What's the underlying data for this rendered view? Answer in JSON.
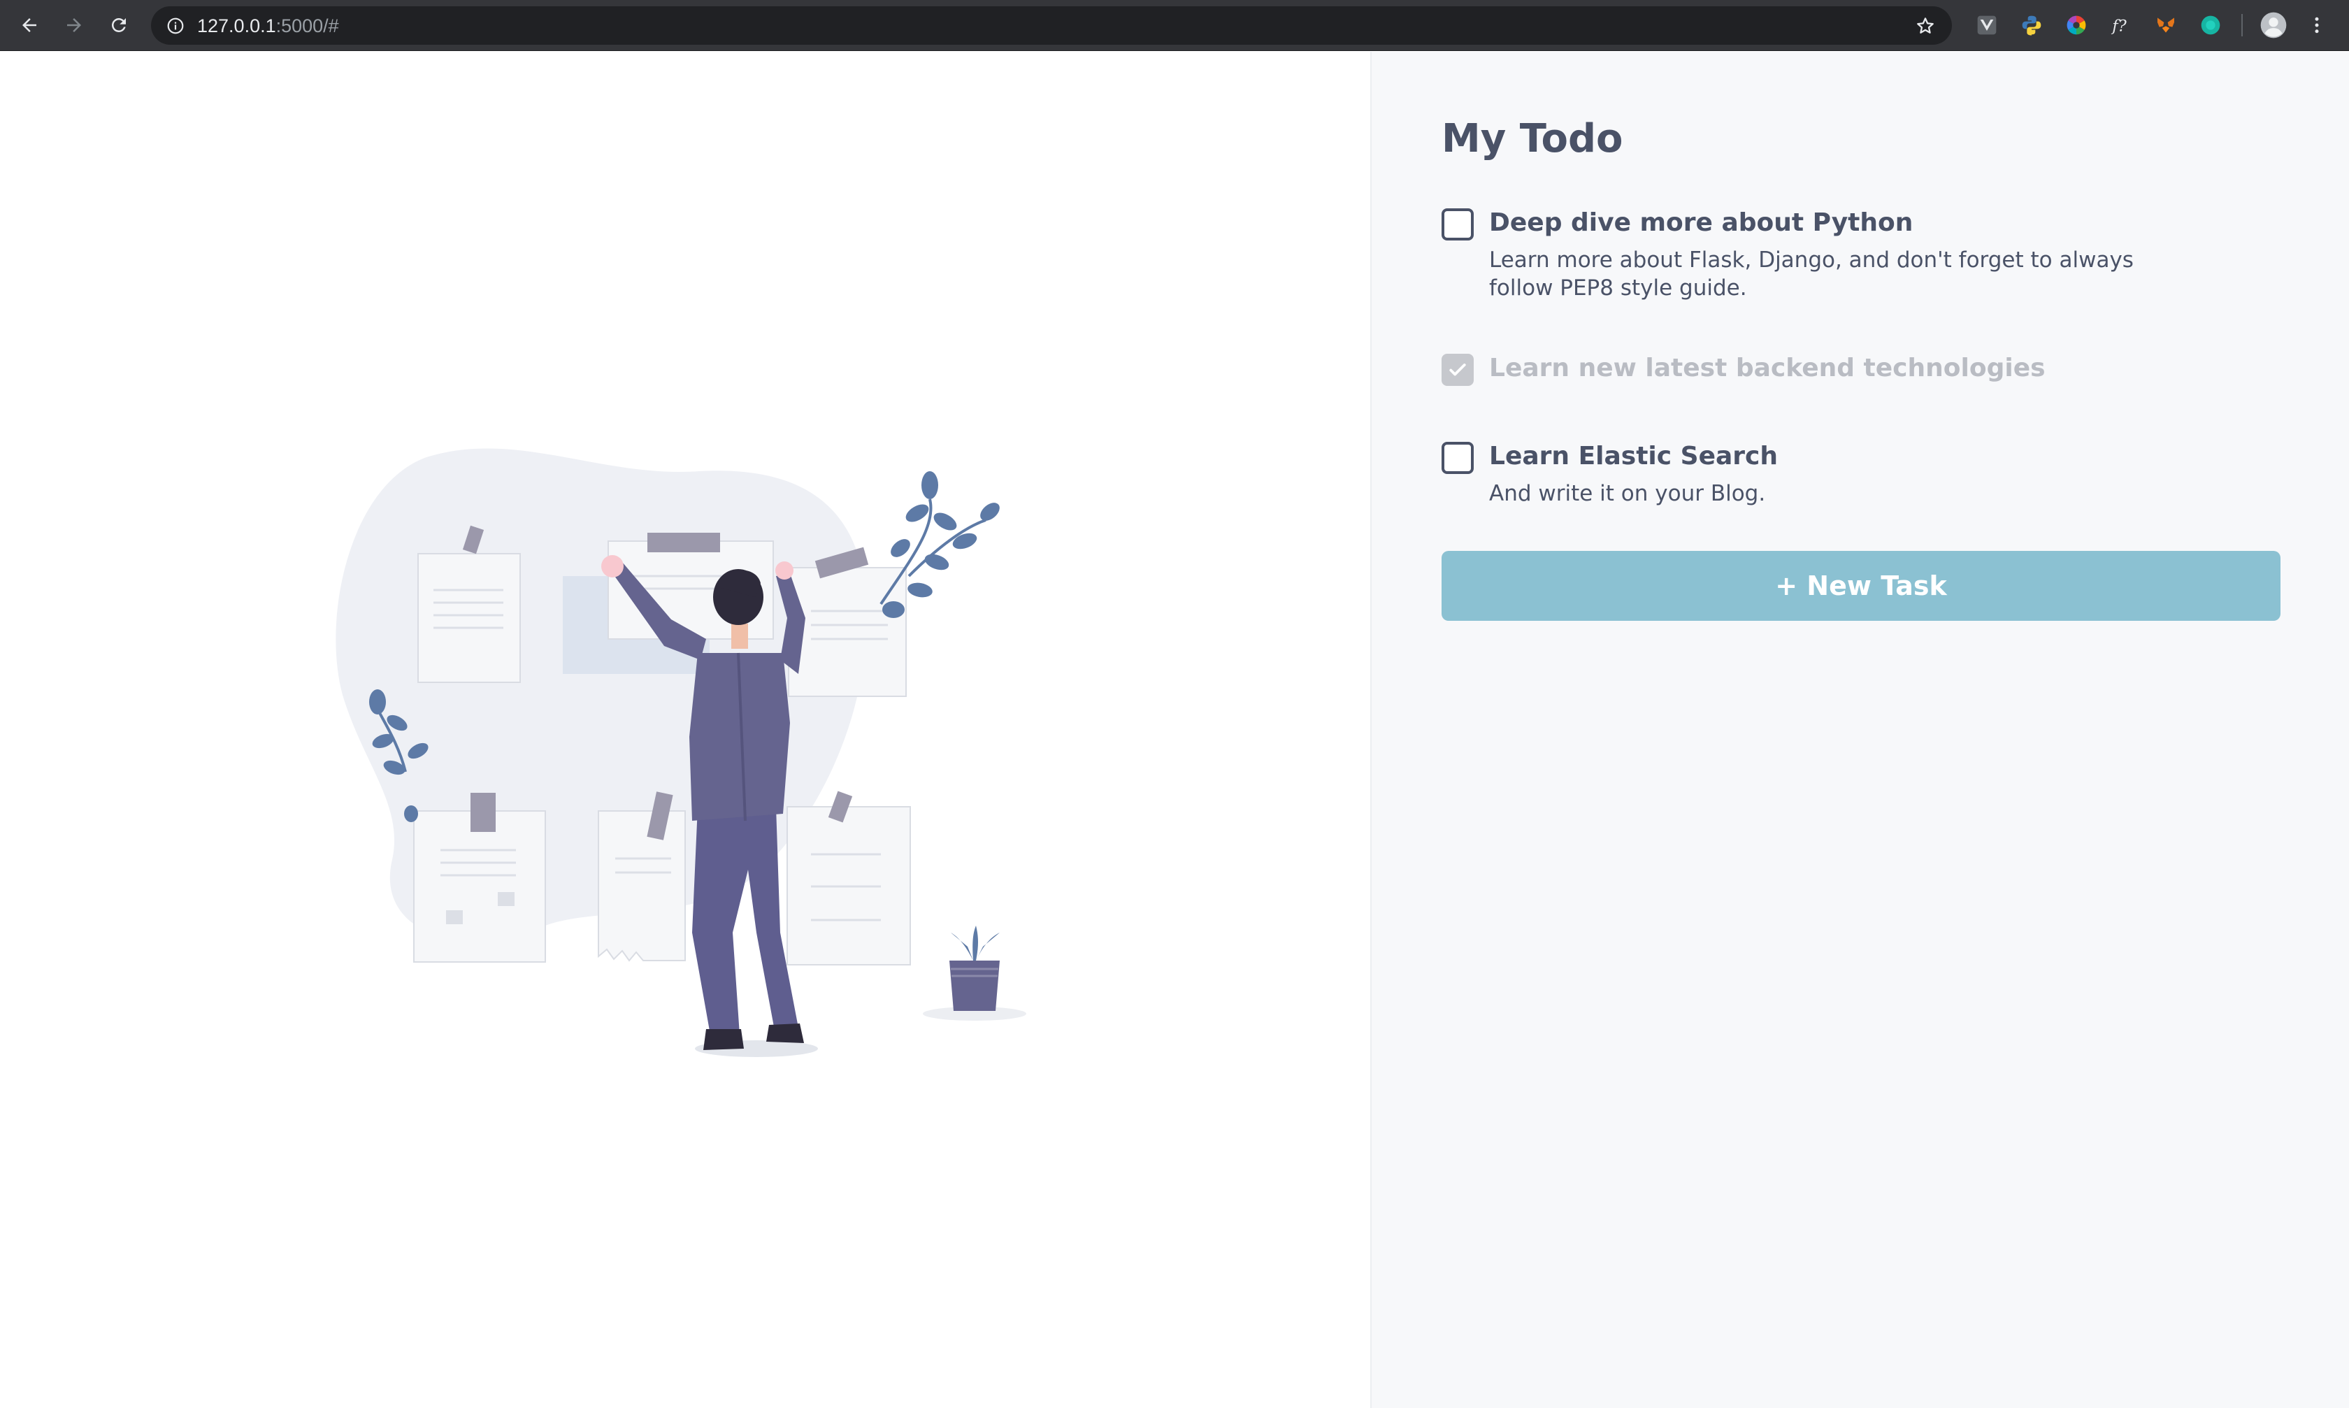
{
  "browser": {
    "url_host": "127.0.0.1",
    "url_rest": ":5000/#",
    "extensions": [
      "vue-devtools-icon",
      "python-icon",
      "color-wheel-icon",
      "font-icon",
      "metamask-icon",
      "teal-circle-icon"
    ]
  },
  "todo": {
    "title": "My Todo",
    "tasks": [
      {
        "title": "Deep dive more about Python",
        "description": "Learn more about Flask, Django, and don't forget to always follow PEP8 style guide.",
        "completed": false
      },
      {
        "title": "Learn new latest backend technologies",
        "description": "",
        "completed": true
      },
      {
        "title": "Learn Elastic Search",
        "description": "And write it on your Blog.",
        "completed": false
      }
    ],
    "new_task_label": "+ New Task"
  },
  "colors": {
    "primary_text": "#4a5267",
    "completed_text": "#b9bcc3",
    "button": "#8bc1d2",
    "pane_background": "#f7f8fa"
  }
}
